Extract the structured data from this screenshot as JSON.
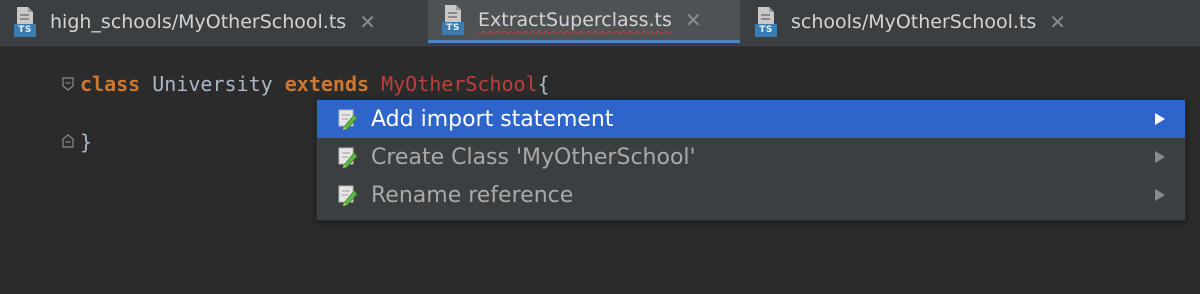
{
  "tabs": [
    {
      "icon": "typescript-file-icon",
      "badge": "TS",
      "label": "high_schools/MyOtherSchool.ts",
      "active": false
    },
    {
      "icon": "typescript-file-icon",
      "badge": "TS",
      "label": "ExtractSuperclass.ts",
      "active": true
    },
    {
      "icon": "typescript-file-icon",
      "badge": "TS",
      "label": "schools/MyOtherSchool.ts",
      "active": false
    }
  ],
  "tab_close_glyph": "✕",
  "code": {
    "line1": {
      "kw1": "class",
      "name": "University",
      "kw2": "extends",
      "super": "MyOtherSchool",
      "brace": "{"
    },
    "line2": {
      "brace": "}"
    }
  },
  "popup": {
    "items": [
      {
        "icon": "pencil-icon",
        "label": "Add import statement",
        "selected": true
      },
      {
        "icon": "pencil-icon",
        "label": "Create Class 'MyOtherSchool'",
        "selected": false
      },
      {
        "icon": "pencil-icon",
        "label": "Rename reference",
        "selected": false
      }
    ]
  },
  "colors": {
    "editor_bg": "#2b2b2b",
    "keyword": "#cc7832",
    "error_ref": "#bc3f3c",
    "selection": "#2f65ca",
    "active_tab_underline": "#4a88c7"
  }
}
